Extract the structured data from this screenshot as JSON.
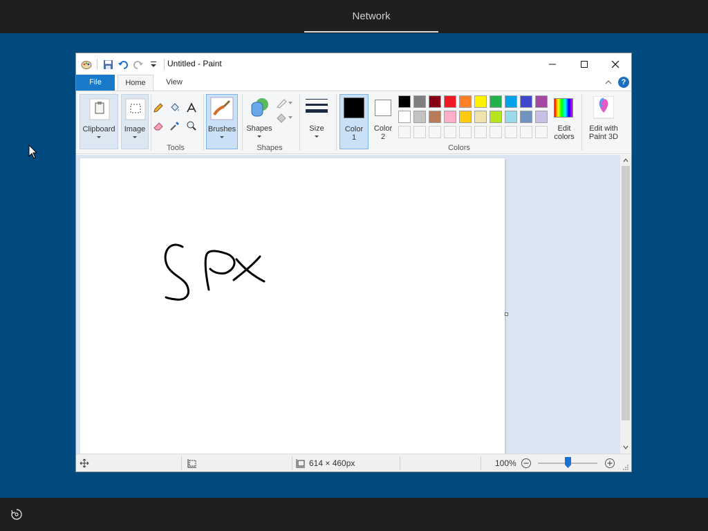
{
  "oobe": {
    "title": "Network"
  },
  "window": {
    "title": "Untitled - Paint",
    "tabs": [
      "File",
      "Home",
      "View"
    ],
    "help_label": "?"
  },
  "ribbon": {
    "clipboard_label": "Clipboard",
    "image_label": "Image",
    "tools_group": "Tools",
    "brushes_label": "Brushes",
    "shapes_label": "Shapes",
    "shapes_group": "Shapes",
    "size_label": "Size",
    "color1_label": [
      "Color",
      "1"
    ],
    "color2_label": [
      "Color",
      "2"
    ],
    "colors_group": "Colors",
    "edit_colors_label": [
      "Edit",
      "colors"
    ],
    "paint3d_label": [
      "Edit with",
      "Paint 3D"
    ],
    "palette_row1": [
      "#000000",
      "#7f7f7f",
      "#880015",
      "#ed1c24",
      "#ff7f27",
      "#fff200",
      "#22b14c",
      "#00a2e8",
      "#3f48cc",
      "#a349a4"
    ],
    "palette_row2": [
      "#ffffff",
      "#c3c3c3",
      "#b97a57",
      "#ffaec9",
      "#ffc90e",
      "#efe4b0",
      "#b5e61d",
      "#99d9ea",
      "#7092be",
      "#c8bfe7"
    ],
    "color1": "#000000",
    "color2": "#ffffff"
  },
  "status": {
    "canvas_size": "614 × 460px",
    "zoom": "100%"
  }
}
